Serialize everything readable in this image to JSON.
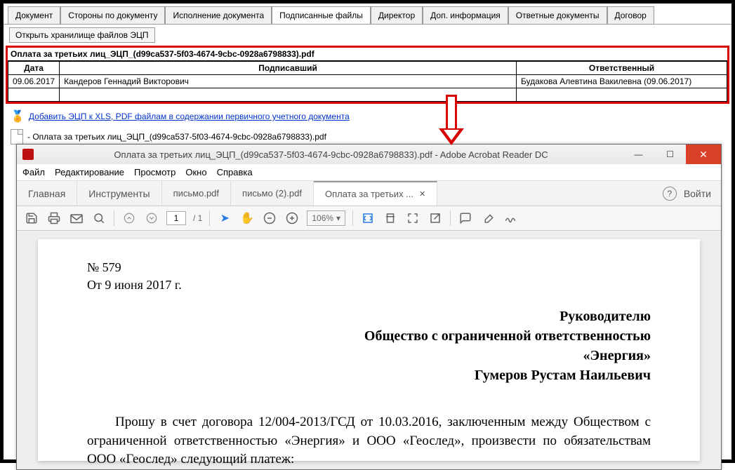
{
  "topTabs": [
    "Документ",
    "Стороны по документу",
    "Исполнение документа",
    "Подписанные файлы",
    "Директор",
    "Доп. информация",
    "Ответные документы",
    "Договор"
  ],
  "activeTopTab": 3,
  "openStorageBtn": "Открыть хранилище файлов ЭЦП",
  "fileName": "Оплата за третьих лиц_ЭЦП_(d99ca537-5f03-4674-9cbc-0928a6798833).pdf",
  "table": {
    "headers": [
      "Дата",
      "Подписавший",
      "Ответственный"
    ],
    "row": {
      "date": "09.06.2017",
      "signer": "Кандеров Геннадий Викторович",
      "responsible": "Будакова Алевтина Вакилевна (09.06.2017)"
    }
  },
  "addSignatureLink": "Добавить ЭЦП к XLS, PDF файлам в содержании первичного учетного документа",
  "fileListItem": "- Оплата за третьих лиц_ЭЦП_(d99ca537-5f03-4674-9cbc-0928a6798833).pdf",
  "adobe": {
    "title": "Оплата за третьих лиц_ЭЦП_(d99ca537-5f03-4674-9cbc-0928a6798833).pdf - Adobe Acrobat Reader DC",
    "menu": [
      "Файл",
      "Редактирование",
      "Просмотр",
      "Окно",
      "Справка"
    ],
    "mainTabs": [
      "Главная",
      "Инструменты"
    ],
    "docTabs": [
      "письмо.pdf",
      "письмо (2).pdf",
      "Оплата за третьих ..."
    ],
    "activeDocTab": 2,
    "login": "Войти",
    "pageNum": "1",
    "pageTotal": "/ 1",
    "zoom": "106%"
  },
  "document": {
    "number": "№ 579",
    "date": "От 9 июня 2017 г.",
    "addr1": "Руководителю",
    "addr2": "Общество с ограниченной ответственностью",
    "addr3": "«Энергия»",
    "addr4": "Гумеров Рустам Наильевич",
    "body": "Прошу в счет договора 12/004-2013/ГСД от 10.03.2016, заключенным между Обществом с ограниченной ответственностью «Энергия» и ООО «Геослед», произвести по обязательствам ООО «Геослед» следующий платеж:"
  }
}
